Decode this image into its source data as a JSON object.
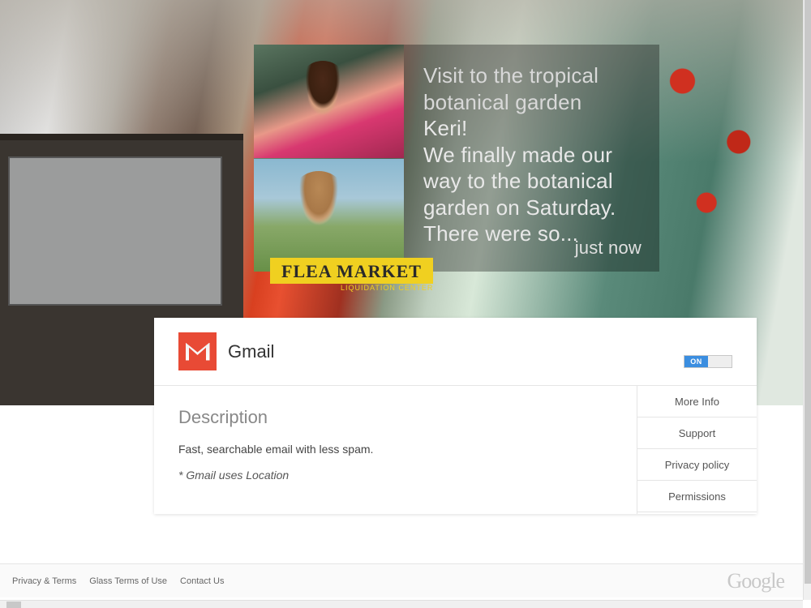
{
  "glass": {
    "title": "Visit to the tropical botanical garden",
    "greeting": "Keri!",
    "body": "We finally made our way to the botanical garden on Saturday. There were so...",
    "timestamp": "just now",
    "flea_sign": "FLEA MARKET",
    "flea_sub": "LIQUIDATION CENTER"
  },
  "app": {
    "name": "Gmail",
    "toggle_label": "ON"
  },
  "description": {
    "heading": "Description",
    "text": "Fast, searchable email with less spam.",
    "note": "* Gmail uses Location"
  },
  "sidelinks": [
    "More Info",
    "Support",
    "Privacy policy",
    "Permissions"
  ],
  "footer": {
    "links": [
      "Privacy & Terms",
      "Glass Terms of Use",
      "Contact Us"
    ],
    "logo": "Google"
  }
}
